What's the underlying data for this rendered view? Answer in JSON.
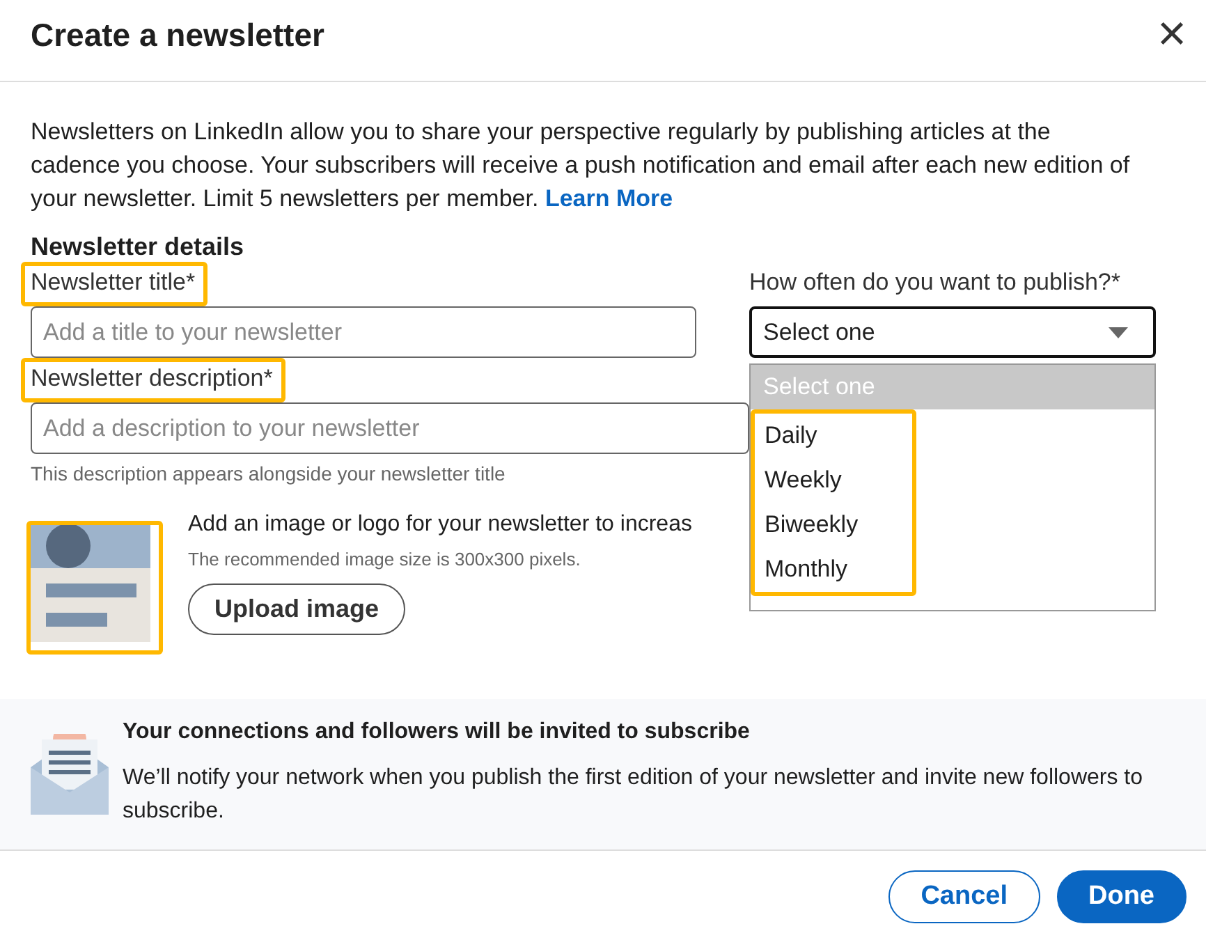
{
  "dialog": {
    "title": "Create a newsletter",
    "close": "×"
  },
  "intro": "Newsletters on LinkedIn allow you to share your perspective regularly by publishing articles at the cadence you choose. Your subscribers will receive a push notification and email after each new edition of your newsletter. Limit 5 newsletters per member.",
  "intro_link": "Learn More",
  "section_title": "Newsletter details",
  "title_field": {
    "label": "Newsletter title*",
    "placeholder": "Add a title to your newsletter",
    "label_highlighted": true
  },
  "frequency": {
    "label": "How often do you want to publish?*",
    "value": "Select one",
    "expanded": true,
    "options_highlighted": true,
    "options": [
      {
        "label": "Select one",
        "selected": true
      },
      {
        "label": "Daily",
        "selected": false
      },
      {
        "label": "Weekly",
        "selected": false
      },
      {
        "label": "Biweekly",
        "selected": false
      },
      {
        "label": "Monthly",
        "selected": false
      }
    ]
  },
  "description_field": {
    "label": "Newsletter description*",
    "placeholder": "Add a description to your newsletter",
    "hint": "This description appears alongside your newsletter title",
    "label_highlighted": true
  },
  "image": {
    "highlighted": true,
    "text": "Add an image or logo for your newsletter to increas",
    "hint": "The recommended image size is 300x300 pixels.",
    "button": "Upload image"
  },
  "notice": {
    "title": "Your connections and followers will be invited to subscribe",
    "text": "We’ll notify your network when you publish the first edition of your newsletter and invite new followers to subscribe."
  },
  "buttons": [
    {
      "label": "Cancel",
      "kind": "secondary"
    },
    {
      "label": "Done",
      "kind": "primary"
    }
  ]
}
